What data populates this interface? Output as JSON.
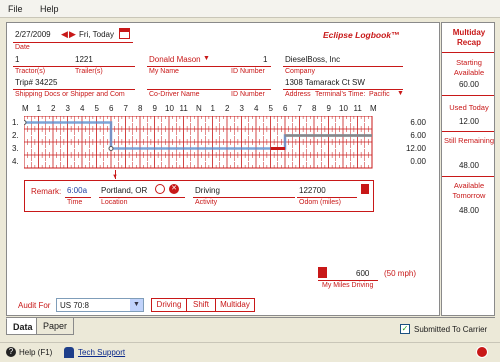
{
  "menu": {
    "file": "File",
    "help": "Help"
  },
  "header": {
    "date": "2/27/2009",
    "day": "Fri, Today",
    "date_label": "Date",
    "app_title": "Eclipse Logbook™"
  },
  "row1": {
    "tractor": "1",
    "tractor_label": "Tractor(s)",
    "trailer": "1221",
    "trailer_label": "Trailer(s)",
    "name": "Donald Mason",
    "name_label": "My Name",
    "id": "1",
    "id_label": "ID Number",
    "company": "DieselBoss, Inc",
    "company_label": "Company"
  },
  "row2": {
    "trip": "Trip# 34225",
    "trip_label": "Shipping Docs or Shipper and Com",
    "codriver_label": "Co-Driver Name",
    "id_label": "ID Number",
    "address": "1308 Tamarack Ct SW",
    "address_label": "Address",
    "terminal_label": "Terminal's Time:",
    "terminal_value": "Pacific"
  },
  "hours": [
    "M",
    "1",
    "2",
    "3",
    "4",
    "5",
    "6",
    "7",
    "8",
    "9",
    "10",
    "11",
    "N",
    "1",
    "2",
    "3",
    "4",
    "5",
    "6",
    "7",
    "8",
    "9",
    "10",
    "11",
    "M"
  ],
  "duty_rows": [
    "1.",
    "2.",
    "3.",
    "4."
  ],
  "duty_totals": [
    "6.00",
    "6.00",
    "12.00",
    "0.00"
  ],
  "remark": {
    "label": "Remark:",
    "time": "6:00a",
    "time_label": "Time",
    "location": "Portland, OR",
    "location_label": "Location",
    "activity": "Driving",
    "activity_label": "Activity",
    "odom": "122700",
    "odom_label": "Odom (miles)"
  },
  "miles": {
    "value": "600",
    "speed": "(50 mph)",
    "label": "My Miles Driving"
  },
  "audit": {
    "label": "Audit For",
    "selected": "US 70:8",
    "buttons": [
      "Driving",
      "Shift",
      "Multiday"
    ]
  },
  "recap": {
    "title": "Multiday Recap",
    "starting_label": "Starting Available",
    "starting_value": "60.00",
    "used_label": "Used Today",
    "used_value": "12.00",
    "still_label": "Still Remaining",
    "still_value": "48.00",
    "tomorrow_label": "Available Tomorrow",
    "tomorrow_value": "48.00"
  },
  "tabs": {
    "data": "Data",
    "paper": "Paper"
  },
  "submitted": "Submitted To Carrier",
  "status": {
    "help": "Help (F1)",
    "tech": "Tech Support"
  },
  "colors": {
    "accent": "#c81818",
    "graph_line": "#5b8fd0"
  }
}
